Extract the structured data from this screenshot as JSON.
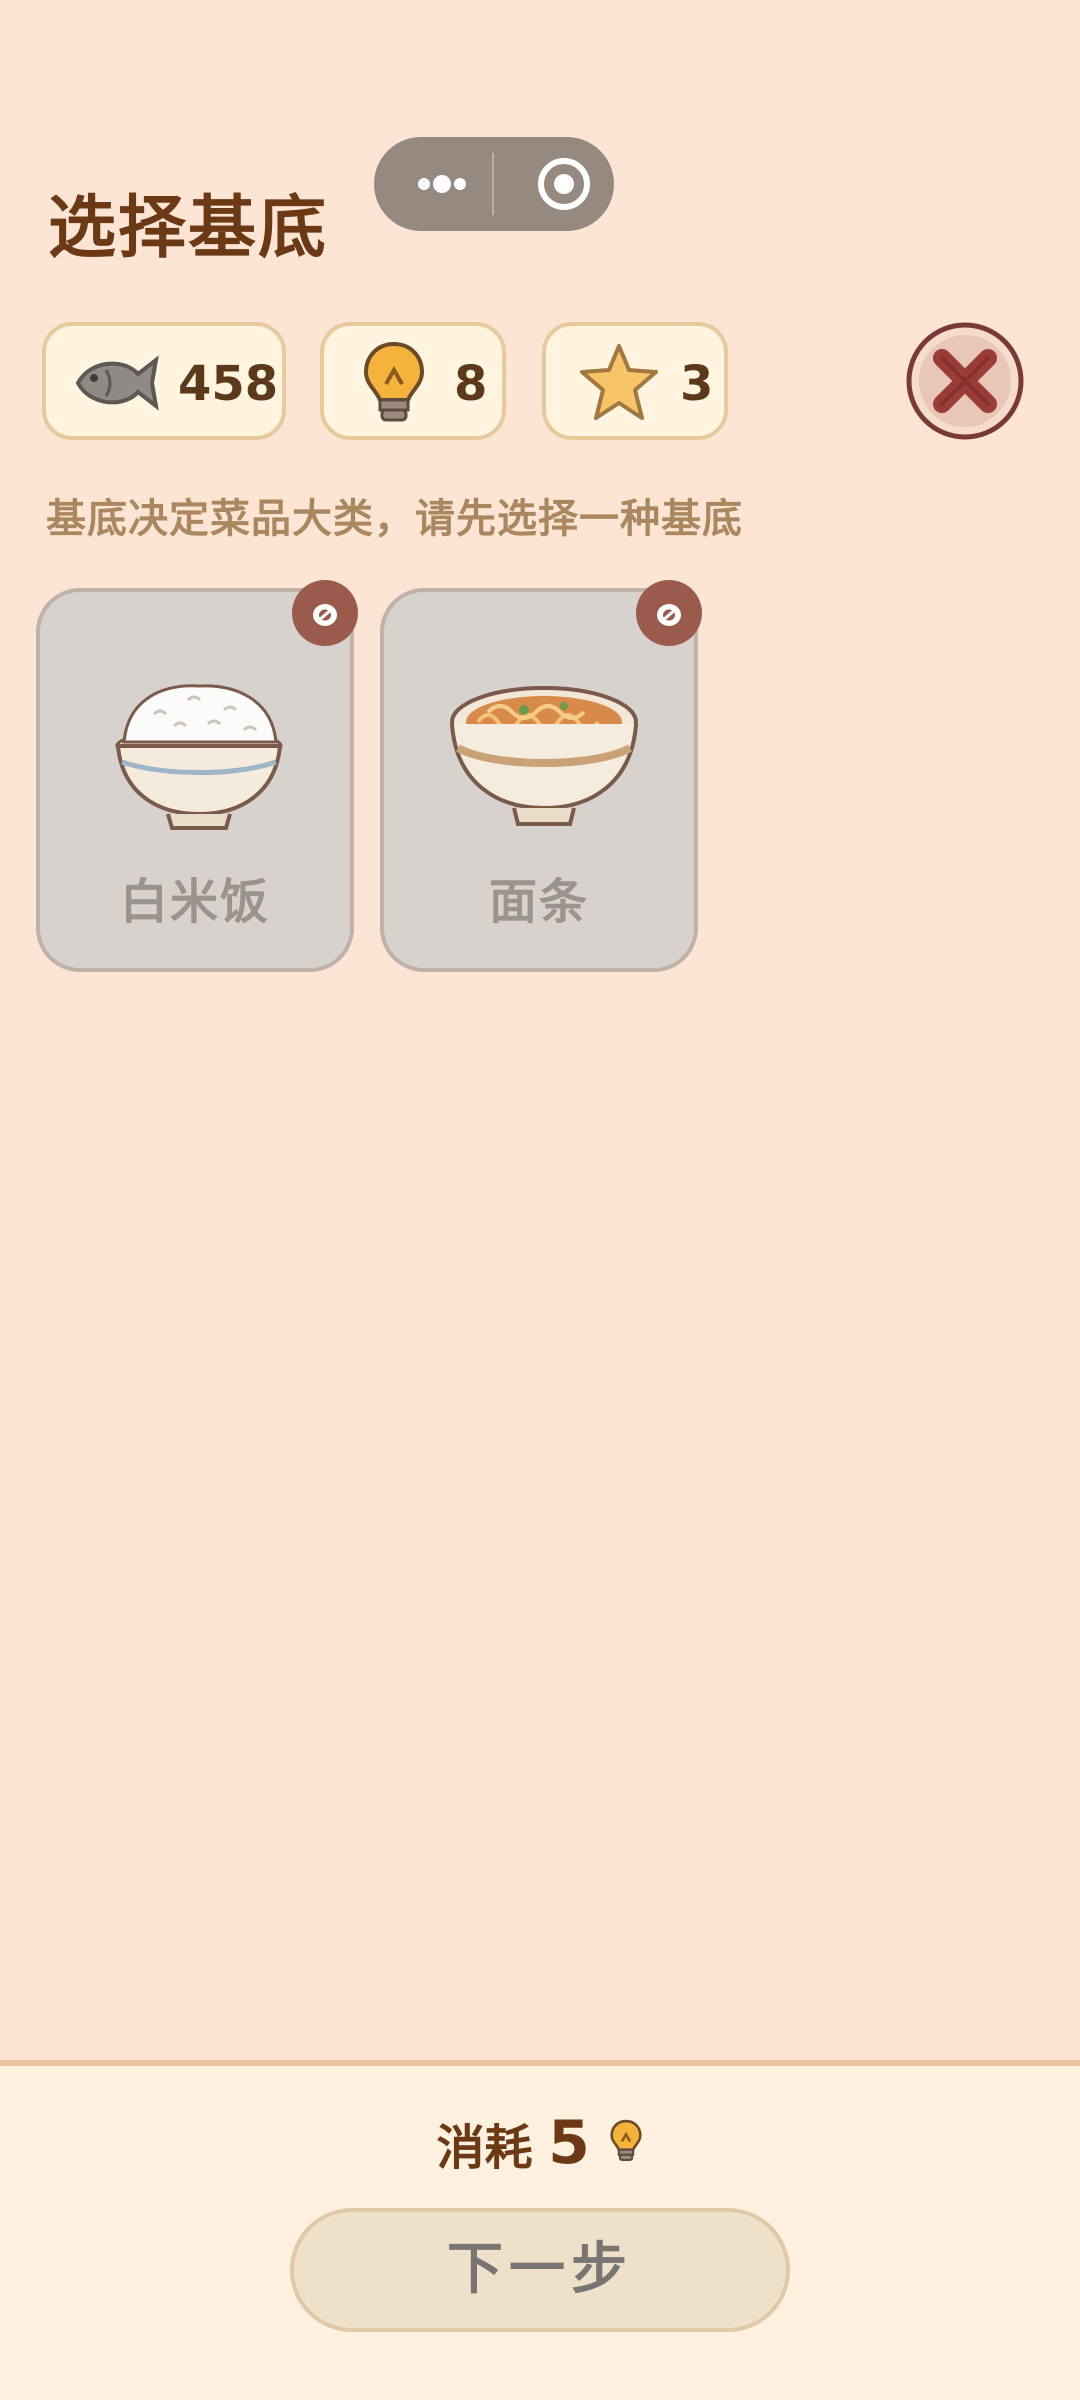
{
  "header": {
    "title": "选择基底"
  },
  "miniapp_capsule": {
    "more_icon": "more-dots-icon",
    "close_icon": "target-circle-icon"
  },
  "stats": [
    {
      "icon": "fish-icon",
      "value": "458"
    },
    {
      "icon": "lightbulb-icon",
      "value": "8"
    },
    {
      "icon": "star-icon",
      "value": "3"
    }
  ],
  "close_button_icon": "close-x-icon",
  "hint": "基底决定菜品大类，请先选择一种基底",
  "bases": [
    {
      "label": "白米饭",
      "icon": "rice-bowl-icon"
    },
    {
      "label": "面条",
      "icon": "noodle-bowl-icon"
    }
  ],
  "footer": {
    "cost_label": "消耗",
    "cost_value": "5",
    "cost_icon": "lightbulb-icon",
    "next_button": "下一步"
  },
  "colors": {
    "background": "#fde5d5",
    "title": "#6b3a14",
    "card_disabled": "#d8d2cf",
    "badge": "#9a5a4c"
  }
}
